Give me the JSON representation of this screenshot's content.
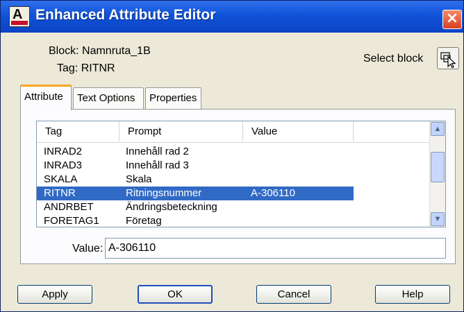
{
  "window": {
    "title": "Enhanced Attribute Editor"
  },
  "header": {
    "block_label": "Block: Namnruta_1B",
    "tag_label": "Tag: RITNR",
    "select_block_label": "Select block"
  },
  "tabs": [
    {
      "label": "Attribute",
      "active": true
    },
    {
      "label": "Text Options",
      "active": false
    },
    {
      "label": "Properties",
      "active": false
    }
  ],
  "attribute_list": {
    "columns": [
      "Tag",
      "Prompt",
      "Value"
    ],
    "rows": [
      {
        "tag": "INRAD2",
        "prompt": "Innehåll rad 2",
        "value": ""
      },
      {
        "tag": "INRAD3",
        "prompt": "Innehåll rad 3",
        "value": ""
      },
      {
        "tag": "SKALA",
        "prompt": "Skala",
        "value": ""
      },
      {
        "tag": "RITNR",
        "prompt": "Ritningsnummer",
        "value": "A-306110",
        "selected": true
      },
      {
        "tag": "ANDRBET",
        "prompt": "Ändringsbeteckning",
        "value": ""
      },
      {
        "tag": "FORETAG1",
        "prompt": "Företag",
        "value": ""
      }
    ]
  },
  "value_field": {
    "label": "Value:",
    "value": "A-306110"
  },
  "buttons": {
    "apply": "Apply",
    "ok": "OK",
    "cancel": "Cancel",
    "help": "Help"
  },
  "icons": {
    "close": "close-icon",
    "select_block": "pick-cursor-icon",
    "scroll_up": "scroll-up-icon",
    "scroll_down": "scroll-down-icon"
  },
  "colors": {
    "titlebar": "#1153d8",
    "selection": "#316ac5",
    "tab_accent": "#f5a623",
    "close_button": "#d9411f"
  }
}
